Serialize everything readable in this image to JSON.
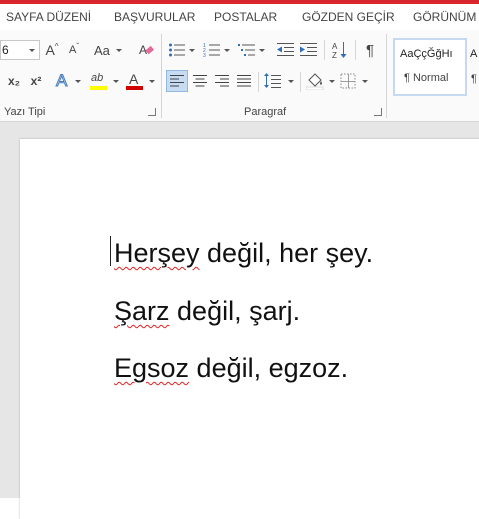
{
  "tabs": [
    "SAYFA DÜZENİ",
    "BAŞVURULAR",
    "POSTALAR",
    "GÖZDEN GEÇİR",
    "GÖRÜNÜM"
  ],
  "font": {
    "size_value": "6",
    "group_label": "Yazı Tipi",
    "case_label": "Aa",
    "subscript": "x₂",
    "superscript": "x²",
    "effects_glyph": "A",
    "font_color_glyph": "A",
    "highlight_glyph": "ab",
    "highlight_color": "#ffff00",
    "font_color": "#d00000",
    "grow_glyph": "A",
    "shrink_glyph": "A"
  },
  "paragraph": {
    "group_label": "Paragraf",
    "pilcrow": "¶",
    "sort_glyph": "A↓Z"
  },
  "styles": {
    "preview_text": "AaÇçĞğHı",
    "normal_label": "¶ Normal",
    "next_preview": "A",
    "next_label": "¶"
  },
  "document": {
    "lines": [
      {
        "misspelled": "Herşey",
        "rest": " değil, her şey."
      },
      {
        "misspelled": "Şarz",
        "rest": " değil, şarj."
      },
      {
        "misspelled": "Egsoz",
        "rest": " değil, egzoz."
      }
    ]
  },
  "colors": {
    "accent_red": "#d8262e",
    "spell_underline": "#e02020",
    "selected_align_bg": "#c5dcf3"
  }
}
